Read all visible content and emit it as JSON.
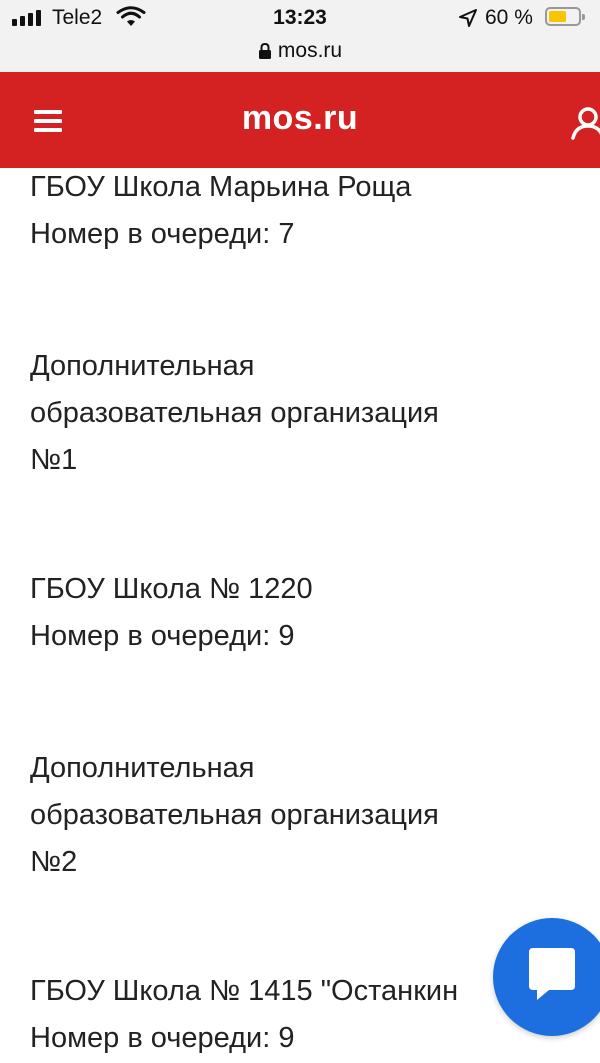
{
  "status_bar": {
    "carrier": "Tele2",
    "time": "13:23",
    "battery_percent": "60 %",
    "battery_level": 0.6,
    "battery_color": "#f7c600"
  },
  "browser": {
    "url": "mos.ru"
  },
  "header": {
    "logo": "mos.ru",
    "color": "#d42222"
  },
  "entries": [
    {
      "lines": [
        "ГБОУ Школа Марьина Роща",
        "Номер в очереди: 7"
      ]
    },
    {
      "lines": [
        "Дополнительная",
        "образовательная организация",
        "№1"
      ]
    },
    {
      "lines": [
        "ГБОУ Школа № 1220",
        "Номер в очереди: 9"
      ]
    },
    {
      "lines": [
        "Дополнительная",
        "образовательная организация",
        "№2"
      ]
    },
    {
      "lines": [
        "ГБОУ Школа № 1415 \"Останкин",
        "Номер в очереди: 9"
      ]
    }
  ],
  "chat_button": {
    "icon": "chat-bubble-icon",
    "color": "#1d6fe0"
  }
}
